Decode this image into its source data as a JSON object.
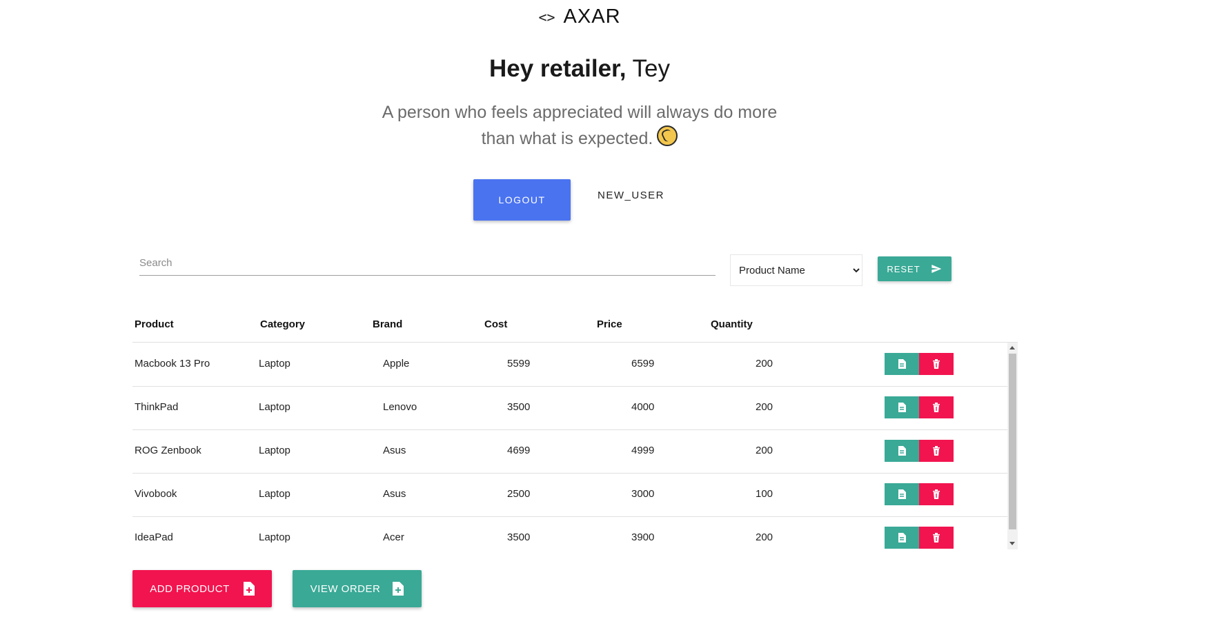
{
  "header": {
    "logo_text": "AXAR",
    "greeting_bold": "Hey retailer,",
    "greeting_name": " Tey",
    "quote_line1": "A person who feels appreciated will always do more",
    "quote_line2": "than what is expected."
  },
  "actions": {
    "logout_label": "LOGOUT",
    "user_label": "NEW_USER"
  },
  "search": {
    "placeholder": "Search",
    "value": ""
  },
  "filter": {
    "selected": "Product Name"
  },
  "reset_label": "RESET",
  "table": {
    "headers": [
      "Product",
      "Category",
      "Brand",
      "Cost",
      "Price",
      "Quantity"
    ],
    "rows": [
      [
        "Macbook 13 Pro",
        "Laptop",
        "Apple",
        "5599",
        "6599",
        "200"
      ],
      [
        "ThinkPad",
        "Laptop",
        "Lenovo",
        "3500",
        "4000",
        "200"
      ],
      [
        "ROG Zenbook",
        "Laptop",
        "Asus",
        "4699",
        "4999",
        "200"
      ],
      [
        "Vivobook",
        "Laptop",
        "Asus",
        "2500",
        "3000",
        "100"
      ],
      [
        "IdeaPad",
        "Laptop",
        "Acer",
        "3500",
        "3900",
        "200"
      ]
    ]
  },
  "bottom": {
    "add_label": "ADD PRODUCT",
    "view_label": "VIEW ORDER"
  },
  "colors": {
    "primary": "#4a73f0",
    "teal": "#3aa996",
    "pink": "#f2144f"
  }
}
